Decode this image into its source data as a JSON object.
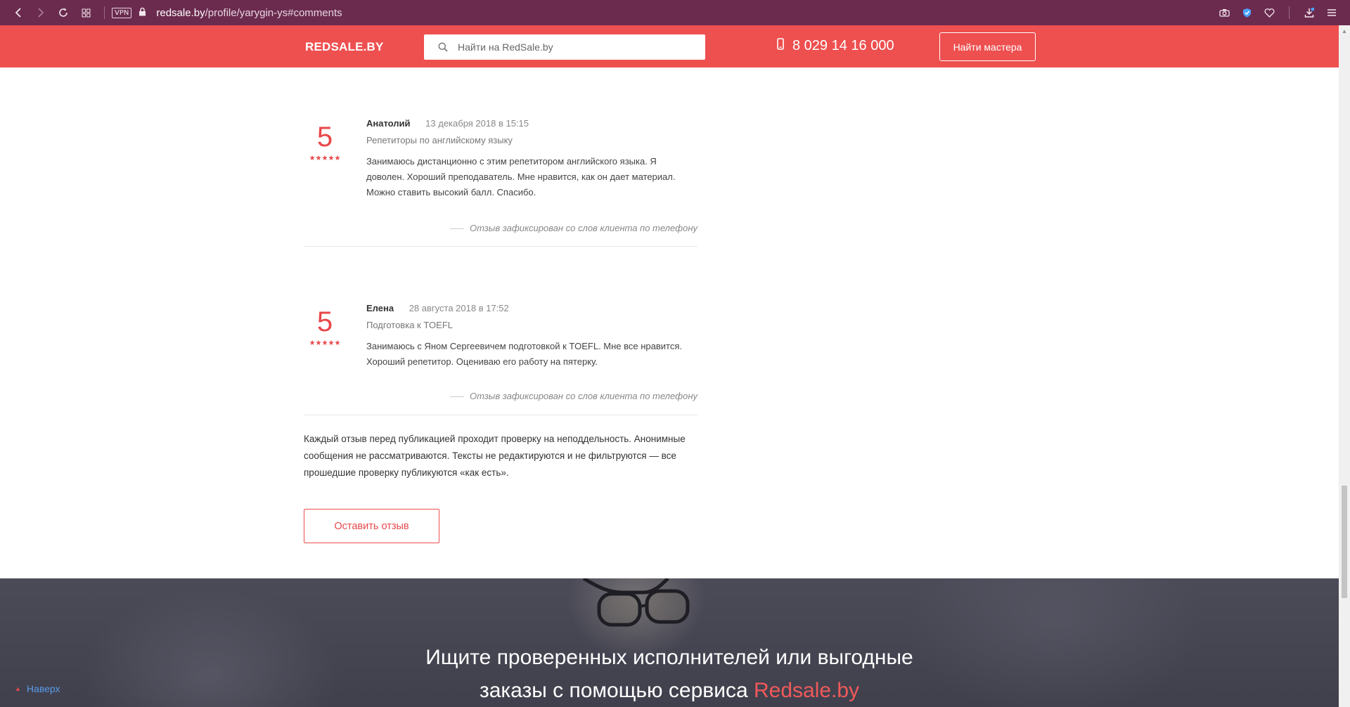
{
  "browser": {
    "url_domain": "redsale.by",
    "url_path": "/profile/yarygin-ys#comments",
    "vpn_label": "VPN",
    "icons": [
      "back-icon",
      "forward-icon",
      "reload-icon",
      "tabs-grid-icon",
      "lock-icon",
      "camera-icon",
      "shield-icon",
      "heart-icon",
      "download-icon",
      "menu-icon"
    ]
  },
  "header": {
    "logo": "REDSALE.BY",
    "search_placeholder": "Найти на RedSale.by",
    "phone": "8 029 14 16 000",
    "find_button": "Найти мастера",
    "accent_color": "#ee4f4f"
  },
  "reviews": [
    {
      "score": "5",
      "stars": "★★★★★",
      "author": "Анатолий",
      "date": "13 декабря 2018 в 15:15",
      "category": "Репетиторы по английскому языку",
      "text": "Занимаюсь дистанционно с этим репетитором английского языка. Я доволен. Хороший преподаватель. Мне нравится, как он дает материал. Можно ставить высокий балл. Спасибо.",
      "note": "Отзыв зафиксирован со слов клиента по телефону"
    },
    {
      "score": "5",
      "stars": "★★★★★",
      "author": "Елена",
      "date": "28 августа 2018 в 17:52",
      "category": "Подготовка к TOEFL",
      "text": "Занимаюсь с Яном Сергеевичем подготовкой к TOEFL. Мне все нравится. Хороший репетитор. Оцениваю его работу на пятерку.",
      "note": "Отзыв зафиксирован со слов клиента по телефону"
    }
  ],
  "disclaimer": "Каждый отзыв перед публикацией проходит проверку на неподдельность. Анонимные сообщения не рассматриваются. Тексты не редактируются и не фильтруются — все прошедшие проверку публикуются «как есть».",
  "leave_review_button": "Оставить отзыв",
  "banner": {
    "line1": "Ищите проверенных исполнителей или выгодные",
    "line2_prefix": "заказы с помощью сервиса ",
    "line2_brand": "Redsale.by"
  },
  "to_top": {
    "arrow": "▲",
    "label": "Наверх"
  }
}
